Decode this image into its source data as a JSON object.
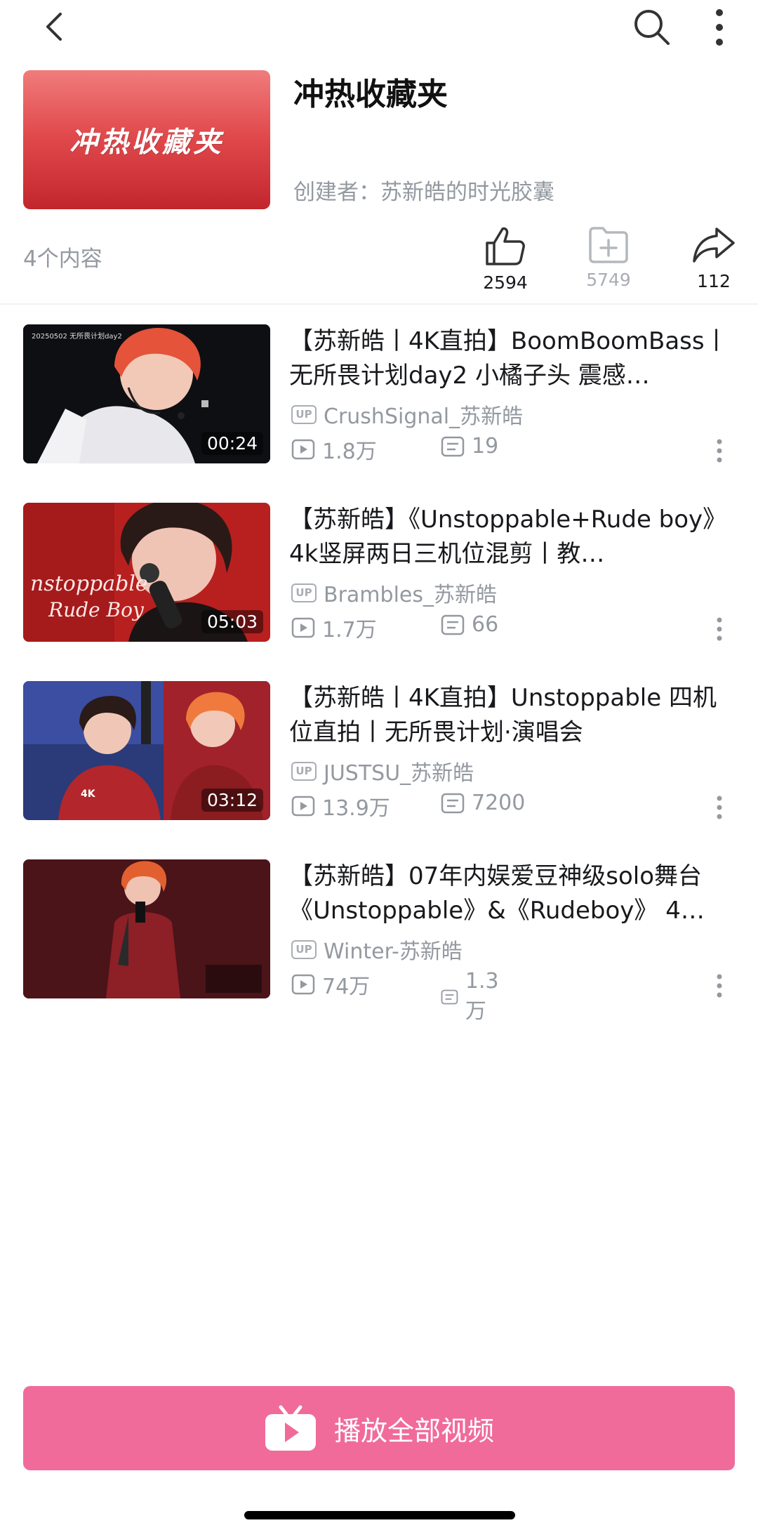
{
  "header": {
    "cover_text": "冲热收藏夹",
    "title": "冲热收藏夹",
    "creator": "创建者：苏新皓的时光胶囊",
    "count": "4个内容"
  },
  "actions": {
    "like": "2594",
    "favorite": "5749",
    "share": "112"
  },
  "videos": [
    {
      "title": "【苏新皓丨4K直拍】BoomBoomBass丨无所畏计划day2 小橘子头 震感…",
      "uploader": "CrushSignal_苏新皓",
      "views": "1.8万",
      "danmaku": "19",
      "duration": "00:24",
      "thumb_caption": "20250502 无所畏计划day2"
    },
    {
      "title": "【苏新皓】《Unstoppable+Rude boy》4k竖屏两日三机位混剪丨教…",
      "uploader": "Brambles_苏新皓",
      "views": "1.7万",
      "danmaku": "66",
      "duration": "05:03",
      "thumb_caption": "nstoppable Rude Boy"
    },
    {
      "title": "【苏新皓丨4K直拍】Unstoppable 四机位直拍丨无所畏计划·演唱会",
      "uploader": "JUSTSU_苏新皓",
      "views": "13.9万",
      "danmaku": "7200",
      "duration": "03:12",
      "thumb_caption": "4K"
    },
    {
      "title": "【苏新皓】07年内娱爱豆神级solo舞台《Unstoppable》&《Rudeboy》 4…",
      "uploader": "Winter-苏新皓",
      "views": "74万",
      "danmaku": "1.3万",
      "duration": "",
      "thumb_caption": ""
    }
  ],
  "play_all": "播放全部视频",
  "up_badge": "UP",
  "colors": {
    "accent": "#f06b9a",
    "cover_red": "#e24b4e",
    "secondary_text": "#9499a0"
  }
}
